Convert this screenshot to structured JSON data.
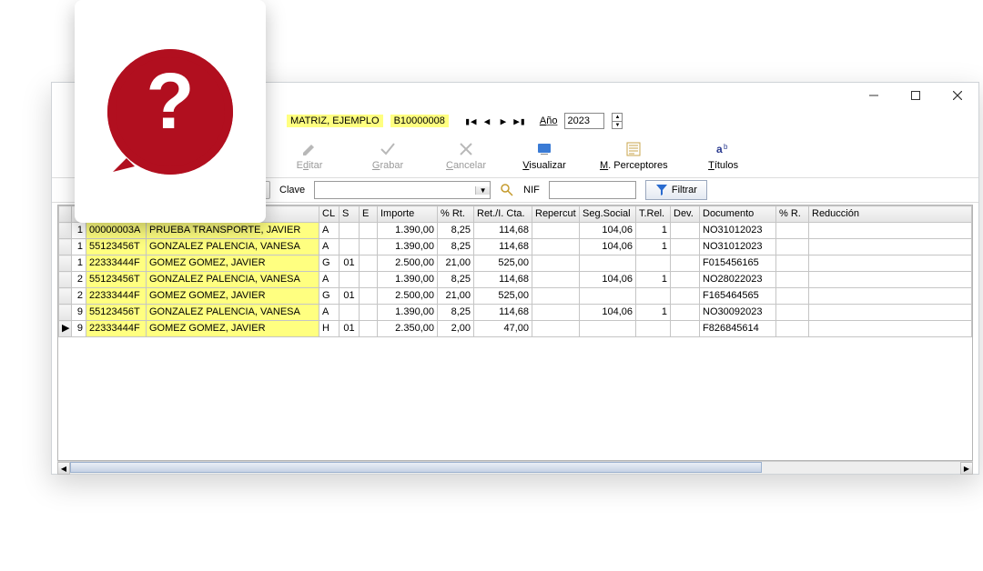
{
  "window": {
    "min_tip": "Minimizar",
    "max_tip": "Maximizar",
    "close_tip": "Cerrar"
  },
  "header": {
    "entity_label": "MATRIZ, EJEMPLO",
    "entity_code": "B10000008",
    "year_label": "Año",
    "year_value": "2023"
  },
  "toolbar": {
    "editar": "Editar",
    "grabar": "Grabar",
    "cancelar": "Cancelar",
    "visualizar": "Visualizar",
    "mperceptores": "M. Perceptores",
    "titulos": "Títulos"
  },
  "filter": {
    "clave_label": "Clave",
    "clave_value": "",
    "nif_label": "NIF",
    "nif_value": "",
    "filtrar_label": "Filtrar"
  },
  "columns": {
    "c0": "",
    "c1": "",
    "c2": "",
    "c3": "",
    "cl": "CL",
    "s": "S",
    "e": "E",
    "importe": "Importe",
    "pct_rt": "% Rt.",
    "ret": "Ret./I. Cta.",
    "reperc": "Repercut",
    "ss": "Seg.Social",
    "trel": "T.Rel.",
    "dev": "Dev.",
    "doc": "Documento",
    "pct_r": "% R.",
    "red": "Reducción"
  },
  "rows": [
    {
      "sel": "",
      "n": "1",
      "nif": "00000003A",
      "nombre": "PRUEBA TRANSPORTE, JAVIER",
      "cl": "A",
      "s": "",
      "e": "",
      "importe": "1.390,00",
      "pct_rt": "8,25",
      "ret": "114,68",
      "reperc": "",
      "ss": "104,06",
      "trel": "1",
      "dev": "",
      "doc": "NO31012023",
      "pct_r": "",
      "red": ""
    },
    {
      "sel": "",
      "n": "1",
      "nif": "55123456T",
      "nombre": "GONZALEZ PALENCIA, VANESA",
      "cl": "A",
      "s": "",
      "e": "",
      "importe": "1.390,00",
      "pct_rt": "8,25",
      "ret": "114,68",
      "reperc": "",
      "ss": "104,06",
      "trel": "1",
      "dev": "",
      "doc": "NO31012023",
      "pct_r": "",
      "red": ""
    },
    {
      "sel": "",
      "n": "1",
      "nif": "22333444F",
      "nombre": "GOMEZ GOMEZ, JAVIER",
      "cl": "G",
      "s": "01",
      "e": "",
      "importe": "2.500,00",
      "pct_rt": "21,00",
      "ret": "525,00",
      "reperc": "",
      "ss": "",
      "trel": "",
      "dev": "",
      "doc": "F015456165",
      "pct_r": "",
      "red": ""
    },
    {
      "sel": "",
      "n": "2",
      "nif": "55123456T",
      "nombre": "GONZALEZ PALENCIA, VANESA",
      "cl": "A",
      "s": "",
      "e": "",
      "importe": "1.390,00",
      "pct_rt": "8,25",
      "ret": "114,68",
      "reperc": "",
      "ss": "104,06",
      "trel": "1",
      "dev": "",
      "doc": "NO28022023",
      "pct_r": "",
      "red": ""
    },
    {
      "sel": "",
      "n": "2",
      "nif": "22333444F",
      "nombre": "GOMEZ GOMEZ, JAVIER",
      "cl": "G",
      "s": "01",
      "e": "",
      "importe": "2.500,00",
      "pct_rt": "21,00",
      "ret": "525,00",
      "reperc": "",
      "ss": "",
      "trel": "",
      "dev": "",
      "doc": "F165464565",
      "pct_r": "",
      "red": ""
    },
    {
      "sel": "",
      "n": "9",
      "nif": "55123456T",
      "nombre": "GONZALEZ PALENCIA, VANESA",
      "cl": "A",
      "s": "",
      "e": "",
      "importe": "1.390,00",
      "pct_rt": "8,25",
      "ret": "114,68",
      "reperc": "",
      "ss": "104,06",
      "trel": "1",
      "dev": "",
      "doc": "NO30092023",
      "pct_r": "",
      "red": ""
    },
    {
      "sel": "▶",
      "n": "9",
      "nif": "22333444F",
      "nombre": "GOMEZ GOMEZ, JAVIER",
      "cl": "H",
      "s": "01",
      "e": "",
      "importe": "2.350,00",
      "pct_rt": "2,00",
      "ret": "47,00",
      "reperc": "",
      "ss": "",
      "trel": "",
      "dev": "",
      "doc": "F826845614",
      "pct_r": "",
      "red": ""
    }
  ]
}
